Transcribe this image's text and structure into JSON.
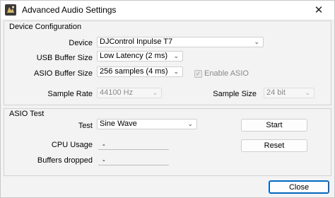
{
  "window": {
    "title": "Advanced Audio Settings",
    "close_glyph": "✕"
  },
  "device_config": {
    "title": "Device Configuration",
    "device": {
      "label": "Device",
      "value": "DJControl Inpulse T7"
    },
    "usb_buffer": {
      "label": "USB Buffer Size",
      "value": "Low Latency (2 ms)"
    },
    "asio_buffer": {
      "label": "ASIO Buffer Size",
      "value": "256 samples (4 ms)"
    },
    "enable_asio": {
      "label": "Enable ASIO",
      "checked": true
    },
    "sample_rate": {
      "label": "Sample Rate",
      "value": "44100 Hz"
    },
    "sample_size": {
      "label": "Sample Size",
      "value": "24 bit"
    }
  },
  "asio_test": {
    "title": "ASIO Test",
    "test": {
      "label": "Test",
      "value": "Sine Wave"
    },
    "cpu_usage": {
      "label": "CPU Usage",
      "value": "-"
    },
    "buffers_dropped": {
      "label": "Buffers dropped",
      "value": "-"
    },
    "start_label": "Start",
    "reset_label": "Reset"
  },
  "close_label": "Close",
  "icons": {
    "dropdown": "chevron-down-icon",
    "app": "app-icon",
    "check": "✓",
    "chevron": "⌄"
  }
}
